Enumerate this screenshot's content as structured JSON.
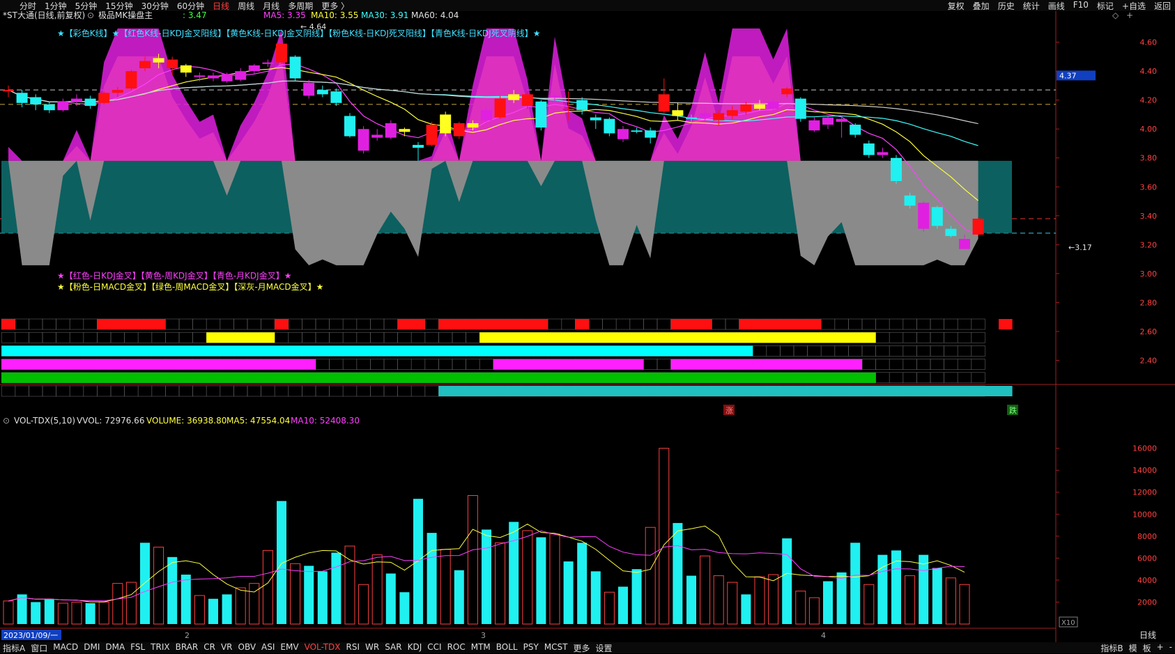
{
  "topbar": {
    "periods": [
      "分时",
      "1分钟",
      "5分钟",
      "15分钟",
      "30分钟",
      "60分钟",
      "日线",
      "周线",
      "月线",
      "多周期",
      "更多 〉"
    ],
    "active_period": "日线",
    "right_buttons": [
      "复权",
      "叠加",
      "历史",
      "统计",
      "画线",
      "F10",
      "标记",
      "+自选",
      "返回"
    ]
  },
  "header": {
    "stock": "*ST大通(日线,前复权)",
    "indicator": "极品MK操盘主",
    "value": ": 3.47",
    "ma": [
      {
        "label": "MA5: 3.35",
        "color": "#ff40ff"
      },
      {
        "label": "MA10: 3.55",
        "color": "#ffff40"
      },
      {
        "label": "MA30: 3.91",
        "color": "#40ffff"
      },
      {
        "label": "MA60: 4.04",
        "color": "#e0e0e0"
      }
    ]
  },
  "legend1": "★【彩色K线】★【红色K线-日KDJ金叉阳线】【黄色K线-日KDJ金叉阴线】【粉色K线-日KDJ死叉阳线】【青色K线-日KDJ死叉阴线】★",
  "legend2": "★【红色-日KDJ金叉】【黄色-周KDJ金叉】【青色-月KDJ金叉】★",
  "legend3": "★【粉色-日MACD金叉】【绿色-周MACD金叉】【深灰-月MACD金叉】★",
  "annotations": {
    "high": "← 4.64",
    "low": "←3.17",
    "zhang": "涨",
    "die": "跌",
    "x10": "X10"
  },
  "price_axis": [
    "4.60",
    "4.40",
    "4.20",
    "4.00",
    "3.80",
    "3.60",
    "3.40",
    "3.20",
    "3.00",
    "2.80",
    "2.60",
    "2.40"
  ],
  "current_price": "4.37",
  "volume_header": {
    "name": "VOL-TDX(5,10)",
    "vvol": "VVOL: 72976.66",
    "volume": "VOLUME: 36938.80",
    "ma5": "MA5: 47554.04",
    "ma10": "MA10: 52408.30"
  },
  "volume_axis": [
    "16000",
    "14000",
    "12000",
    "10000",
    "8000",
    "6000",
    "4000",
    "2000"
  ],
  "date_axis": {
    "start": "2023/01/09/一",
    "m2": "2",
    "m3": "3",
    "m4": "4",
    "period": "日线"
  },
  "bottom_tabs": [
    "指标A",
    "窗口",
    "MACD",
    "DMI",
    "DMA",
    "FSL",
    "TRIX",
    "BRAR",
    "CR",
    "VR",
    "OBV",
    "ASI",
    "EMV",
    "VOL-TDX",
    "RSI",
    "WR",
    "SAR",
    "KDJ",
    "CCI",
    "ROC",
    "MTM",
    "BOLL",
    "PSY",
    "MCST",
    "更多",
    "设置"
  ],
  "active_tab": "VOL-TDX",
  "bottom_right": [
    "指标B",
    "模",
    "板",
    "+",
    "-"
  ],
  "chart_data": {
    "type": "candlestick",
    "price_range": [
      2.33,
      4.68
    ],
    "candles": [
      {
        "o": 4.26,
        "c": 4.27,
        "h": 4.3,
        "l": 4.22,
        "col": "red"
      },
      {
        "o": 4.25,
        "c": 4.18,
        "h": 4.27,
        "l": 4.15,
        "col": "cyan"
      },
      {
        "o": 4.22,
        "c": 4.17,
        "h": 4.24,
        "l": 4.13,
        "col": "cyan"
      },
      {
        "o": 4.17,
        "c": 4.13,
        "h": 4.19,
        "l": 4.11,
        "col": "cyan"
      },
      {
        "o": 4.13,
        "c": 4.19,
        "h": 4.21,
        "l": 4.12,
        "col": "pink"
      },
      {
        "o": 4.19,
        "c": 4.21,
        "h": 4.24,
        "l": 4.16,
        "col": "pink"
      },
      {
        "o": 4.21,
        "c": 4.16,
        "h": 4.23,
        "l": 4.14,
        "col": "cyan"
      },
      {
        "o": 4.18,
        "c": 4.25,
        "h": 4.26,
        "l": 4.17,
        "col": "red"
      },
      {
        "o": 4.25,
        "c": 4.27,
        "h": 4.29,
        "l": 4.22,
        "col": "red"
      },
      {
        "o": 4.28,
        "c": 4.4,
        "h": 4.41,
        "l": 4.27,
        "col": "red"
      },
      {
        "o": 4.42,
        "c": 4.47,
        "h": 4.5,
        "l": 4.4,
        "col": "red"
      },
      {
        "o": 4.46,
        "c": 4.49,
        "h": 4.52,
        "l": 4.42,
        "col": "yellow"
      },
      {
        "o": 4.48,
        "c": 4.42,
        "h": 4.5,
        "l": 4.37,
        "col": "red"
      },
      {
        "o": 4.44,
        "c": 4.39,
        "h": 4.45,
        "l": 4.36,
        "col": "yellow"
      },
      {
        "o": 4.37,
        "c": 4.36,
        "h": 4.39,
        "l": 4.33,
        "col": "pink"
      },
      {
        "o": 4.35,
        "c": 4.37,
        "h": 4.39,
        "l": 4.33,
        "col": "pink"
      },
      {
        "o": 4.38,
        "c": 4.33,
        "h": 4.39,
        "l": 4.32,
        "col": "pink"
      },
      {
        "o": 4.34,
        "c": 4.4,
        "h": 4.42,
        "l": 4.33,
        "col": "pink"
      },
      {
        "o": 4.4,
        "c": 4.44,
        "h": 4.45,
        "l": 4.38,
        "col": "pink"
      },
      {
        "o": 4.45,
        "c": 4.46,
        "h": 4.48,
        "l": 4.43,
        "col": "pink"
      },
      {
        "o": 4.46,
        "c": 4.59,
        "h": 4.64,
        "l": 4.45,
        "col": "red"
      },
      {
        "o": 4.5,
        "c": 4.35,
        "h": 4.51,
        "l": 4.33,
        "col": "cyan"
      },
      {
        "o": 4.32,
        "c": 4.23,
        "h": 4.34,
        "l": 4.21,
        "col": "pink"
      },
      {
        "o": 4.27,
        "c": 4.24,
        "h": 4.3,
        "l": 4.22,
        "col": "cyan"
      },
      {
        "o": 4.26,
        "c": 4.18,
        "h": 4.28,
        "l": 4.16,
        "col": "cyan"
      },
      {
        "o": 4.09,
        "c": 3.95,
        "h": 4.11,
        "l": 3.94,
        "col": "cyan"
      },
      {
        "o": 4.0,
        "c": 3.85,
        "h": 4.02,
        "l": 3.83,
        "col": "pink"
      },
      {
        "o": 3.94,
        "c": 3.96,
        "h": 4.0,
        "l": 3.92,
        "col": "pink"
      },
      {
        "o": 3.94,
        "c": 4.04,
        "h": 4.06,
        "l": 3.93,
        "col": "pink"
      },
      {
        "o": 4.0,
        "c": 3.98,
        "h": 4.01,
        "l": 3.95,
        "col": "yellow"
      },
      {
        "o": 3.89,
        "c": 3.87,
        "h": 3.91,
        "l": 3.78,
        "col": "cyan"
      },
      {
        "o": 3.89,
        "c": 4.03,
        "h": 4.05,
        "l": 3.88,
        "col": "red"
      },
      {
        "o": 3.97,
        "c": 4.1,
        "h": 4.12,
        "l": 3.95,
        "col": "yellow"
      },
      {
        "o": 4.04,
        "c": 3.95,
        "h": 4.05,
        "l": 3.93,
        "col": "red"
      },
      {
        "o": 4.01,
        "c": 4.04,
        "h": 4.06,
        "l": 3.99,
        "col": "yellow"
      },
      {
        "o": 4.06,
        "c": 4.13,
        "h": 4.15,
        "l": 4.05,
        "col": "pink"
      },
      {
        "o": 4.08,
        "c": 4.21,
        "h": 4.23,
        "l": 4.07,
        "col": "red"
      },
      {
        "o": 4.2,
        "c": 4.24,
        "h": 4.27,
        "l": 4.18,
        "col": "yellow"
      },
      {
        "o": 4.24,
        "c": 4.16,
        "h": 4.26,
        "l": 4.14,
        "col": "red"
      },
      {
        "o": 4.19,
        "c": 4.01,
        "h": 4.2,
        "l": 3.99,
        "col": "cyan"
      },
      {
        "o": 4.22,
        "c": 4.23,
        "h": 4.25,
        "l": 4.18,
        "col": "pink"
      },
      {
        "o": 4.14,
        "c": 4.14,
        "h": 4.26,
        "l": 4.06,
        "col": "red"
      },
      {
        "o": 4.2,
        "c": 4.13,
        "h": 4.22,
        "l": 4.1,
        "col": "cyan"
      },
      {
        "o": 4.08,
        "c": 4.06,
        "h": 4.1,
        "l": 4.0,
        "col": "cyan"
      },
      {
        "o": 4.07,
        "c": 3.97,
        "h": 4.08,
        "l": 3.95,
        "col": "cyan"
      },
      {
        "o": 4.0,
        "c": 3.93,
        "h": 4.02,
        "l": 3.91,
        "col": "pink"
      },
      {
        "o": 3.99,
        "c": 3.99,
        "h": 4.01,
        "l": 3.97,
        "col": "cyan"
      },
      {
        "o": 3.99,
        "c": 3.94,
        "h": 4.01,
        "l": 3.9,
        "col": "cyan"
      },
      {
        "o": 4.24,
        "c": 4.12,
        "h": 4.35,
        "l": 4.11,
        "col": "red"
      },
      {
        "o": 4.13,
        "c": 4.09,
        "h": 4.18,
        "l": 4.06,
        "col": "yellow"
      },
      {
        "o": 4.08,
        "c": 4.07,
        "h": 4.1,
        "l": 4.05,
        "col": "cyan"
      },
      {
        "o": 4.08,
        "c": 4.11,
        "h": 4.15,
        "l": 4.05,
        "col": "pink"
      },
      {
        "o": 4.11,
        "c": 4.06,
        "h": 4.13,
        "l": 4.02,
        "col": "red"
      },
      {
        "o": 4.09,
        "c": 4.13,
        "h": 4.16,
        "l": 4.07,
        "col": "red"
      },
      {
        "o": 4.12,
        "c": 4.17,
        "h": 4.19,
        "l": 4.1,
        "col": "red"
      },
      {
        "o": 4.14,
        "c": 4.17,
        "h": 4.2,
        "l": 4.13,
        "col": "yellow"
      },
      {
        "o": 4.19,
        "c": 4.14,
        "h": 4.21,
        "l": 4.12,
        "col": "pink"
      },
      {
        "o": 4.24,
        "c": 4.28,
        "h": 4.29,
        "l": 4.22,
        "col": "red"
      },
      {
        "o": 4.21,
        "c": 4.07,
        "h": 4.22,
        "l": 4.05,
        "col": "cyan"
      },
      {
        "o": 4.06,
        "c": 3.99,
        "h": 4.08,
        "l": 3.98,
        "col": "pink"
      },
      {
        "o": 4.08,
        "c": 4.03,
        "h": 4.09,
        "l": 4.0,
        "col": "pink"
      },
      {
        "o": 4.07,
        "c": 4.05,
        "h": 4.09,
        "l": 3.94,
        "col": "pink"
      },
      {
        "o": 4.03,
        "c": 3.96,
        "h": 4.04,
        "l": 3.94,
        "col": "cyan"
      },
      {
        "o": 3.9,
        "c": 3.82,
        "h": 3.92,
        "l": 3.8,
        "col": "cyan"
      },
      {
        "o": 3.84,
        "c": 3.82,
        "h": 3.87,
        "l": 3.8,
        "col": "pink"
      },
      {
        "o": 3.8,
        "c": 3.64,
        "h": 3.82,
        "l": 3.62,
        "col": "cyan"
      },
      {
        "o": 3.54,
        "c": 3.47,
        "h": 3.56,
        "l": 3.45,
        "col": "cyan"
      },
      {
        "o": 3.49,
        "c": 3.31,
        "h": 3.5,
        "l": 3.29,
        "col": "pink"
      },
      {
        "o": 3.46,
        "c": 3.33,
        "h": 3.47,
        "l": 3.31,
        "col": "cyan"
      },
      {
        "o": 3.31,
        "c": 3.26,
        "h": 3.33,
        "l": 3.25,
        "col": "cyan"
      },
      {
        "o": 3.24,
        "c": 3.17,
        "h": 3.27,
        "l": 3.17,
        "col": "pink"
      },
      {
        "o": 3.38,
        "c": 3.27,
        "h": 3.39,
        "l": 3.26,
        "col": "red"
      }
    ],
    "volume_range": [
      0,
      17500
    ],
    "volumes": [
      2100,
      2700,
      2000,
      2300,
      1900,
      2000,
      1900,
      2000,
      3700,
      3800,
      7400,
      7000,
      6100,
      4500,
      2600,
      2300,
      2700,
      3300,
      3700,
      6700,
      11200,
      5500,
      5300,
      4800,
      6500,
      7100,
      3600,
      6300,
      4600,
      2900,
      11400,
      8300,
      6800,
      4900,
      11700,
      8600,
      7400,
      9300,
      8500,
      7900,
      8200,
      5700,
      7400,
      4800,
      2900,
      3400,
      5000,
      8800,
      16000,
      9200,
      4400,
      6200,
      4400,
      3800,
      2700,
      4300,
      4500,
      7800,
      3000,
      2400,
      3900,
      4700,
      7400,
      3600,
      6300,
      6700,
      4400,
      6300,
      5100,
      4200,
      3600
    ],
    "volume_colors": [
      "h",
      "c",
      "c",
      "c",
      "h",
      "h",
      "c",
      "h",
      "h",
      "h",
      "c",
      "h",
      "c",
      "c",
      "h",
      "c",
      "c",
      "h",
      "h",
      "h",
      "c",
      "h",
      "c",
      "c",
      "c",
      "h",
      "h",
      "h",
      "c",
      "c",
      "c",
      "c",
      "h",
      "c",
      "h",
      "c",
      "h",
      "c",
      "h",
      "c",
      "h",
      "c",
      "c",
      "c",
      "h",
      "c",
      "c",
      "h",
      "h",
      "c",
      "c",
      "h",
      "h",
      "h",
      "c",
      "h",
      "h",
      "c",
      "h",
      "h",
      "c",
      "c",
      "c",
      "h",
      "c",
      "c",
      "h",
      "c",
      "c",
      "h",
      "h"
    ],
    "signal_rows": [
      {
        "color": "#ff1010",
        "runs": [
          [
            0,
            1
          ],
          [
            7,
            12
          ],
          [
            20,
            21
          ],
          [
            29,
            31
          ],
          [
            32,
            40
          ],
          [
            42,
            43
          ],
          [
            49,
            52
          ],
          [
            54,
            60
          ],
          [
            73,
            74
          ]
        ]
      },
      {
        "color": "#ffff00",
        "runs": [
          [
            15,
            20
          ],
          [
            35,
            64
          ]
        ]
      },
      {
        "color": "#00ffff",
        "runs": [
          [
            0,
            55
          ]
        ]
      },
      {
        "color": "#ff20ff",
        "runs": [
          [
            0,
            23
          ],
          [
            36,
            47
          ],
          [
            49,
            63
          ]
        ]
      },
      {
        "color": "#00c000",
        "runs": [
          [
            0,
            64
          ]
        ]
      },
      {
        "color": "#20c0c0",
        "runs": [
          [
            32,
            74
          ]
        ]
      }
    ]
  }
}
